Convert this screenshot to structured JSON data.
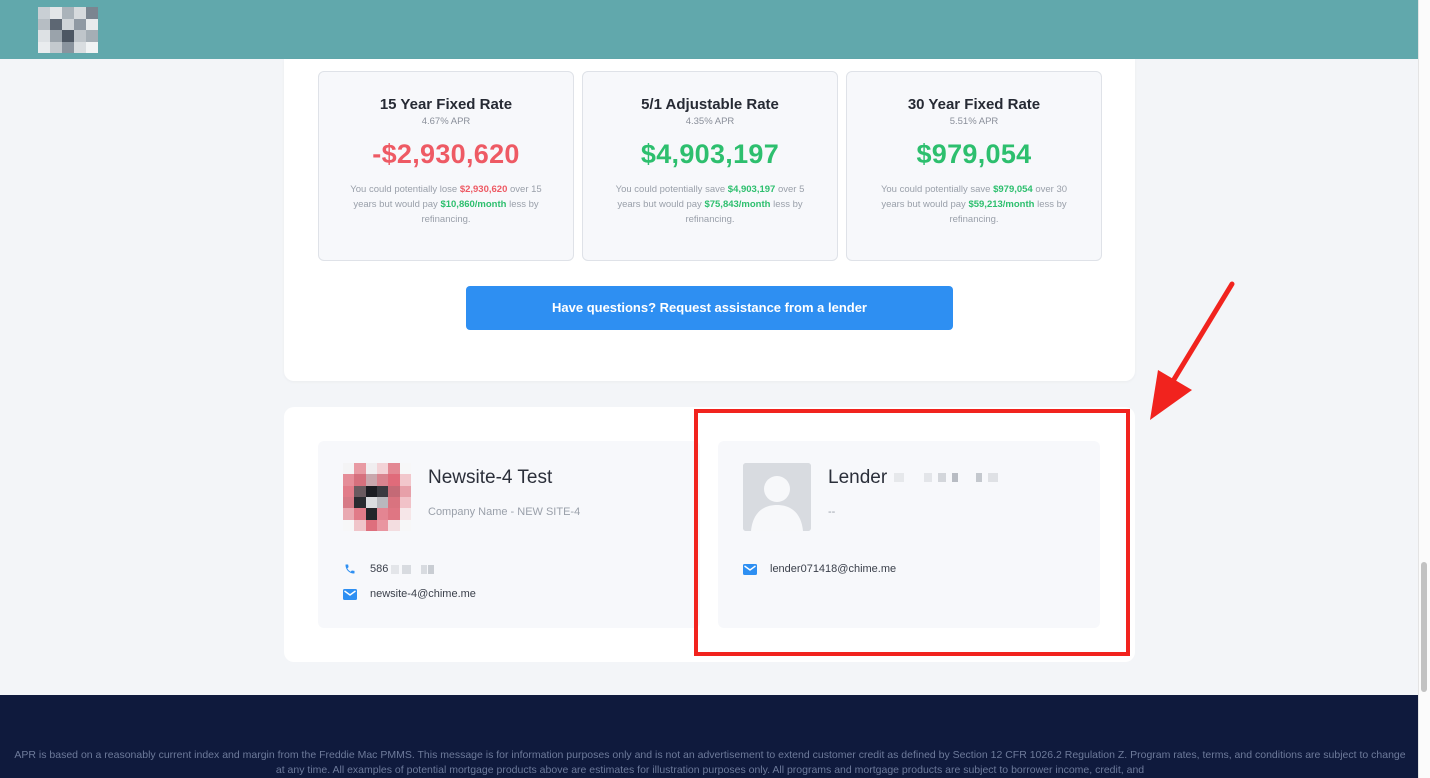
{
  "colors": {
    "header": "#61a8ac",
    "negative": "#ee5a64",
    "positive": "#2dbf6e",
    "cta": "#2e8ff2",
    "footer": "#0f1a3d",
    "annotation": "#f1231e"
  },
  "rates": [
    {
      "title": "15 Year Fixed Rate",
      "apr": "4.67% APR",
      "amount": "-$2,930,620",
      "tone": "negative",
      "desc_pre": "You could potentially lose ",
      "desc_amount": "$2,930,620",
      "desc_mid": " over 15 years but would pay ",
      "desc_monthly": "$10,860/month",
      "desc_post": " less by refinancing."
    },
    {
      "title": "5/1 Adjustable Rate",
      "apr": "4.35% APR",
      "amount": "$4,903,197",
      "tone": "positive",
      "desc_pre": "You could potentially save ",
      "desc_amount": "$4,903,197",
      "desc_mid": " over 5 years but would pay ",
      "desc_monthly": "$75,843/month",
      "desc_post": " less by refinancing."
    },
    {
      "title": "30 Year Fixed Rate",
      "apr": "5.51% APR",
      "amount": "$979,054",
      "tone": "positive",
      "desc_pre": "You could potentially save ",
      "desc_amount": "$979,054",
      "desc_mid": " over 30 years but would pay ",
      "desc_monthly": "$59,213/month",
      "desc_post": " less by refinancing."
    }
  ],
  "cta_label": "Have questions? Request assistance from a lender",
  "agent": {
    "name": "Newsite-4 Test",
    "company": "Company Name - NEW SITE-4",
    "phone": "586",
    "email": "newsite-4@chime.me",
    "phone_icon": "phone-icon",
    "email_icon": "mail-icon"
  },
  "lender": {
    "name": "Lender",
    "subtitle": "--",
    "email": "lender071418@chime.me",
    "email_icon": "mail-icon"
  },
  "footer_text": "APR is based on a reasonably current index and margin from the Freddie Mac PMMS. This message is for information purposes only and is not an advertisement to extend customer credit as defined by Section 12 CFR 1026.2 Regulation Z. Program rates, terms, and conditions are subject to change at any time. All examples of potential mortgage products above are estimates for illustration purposes only. All programs and mortgage products are subject to borrower income, credit, and"
}
